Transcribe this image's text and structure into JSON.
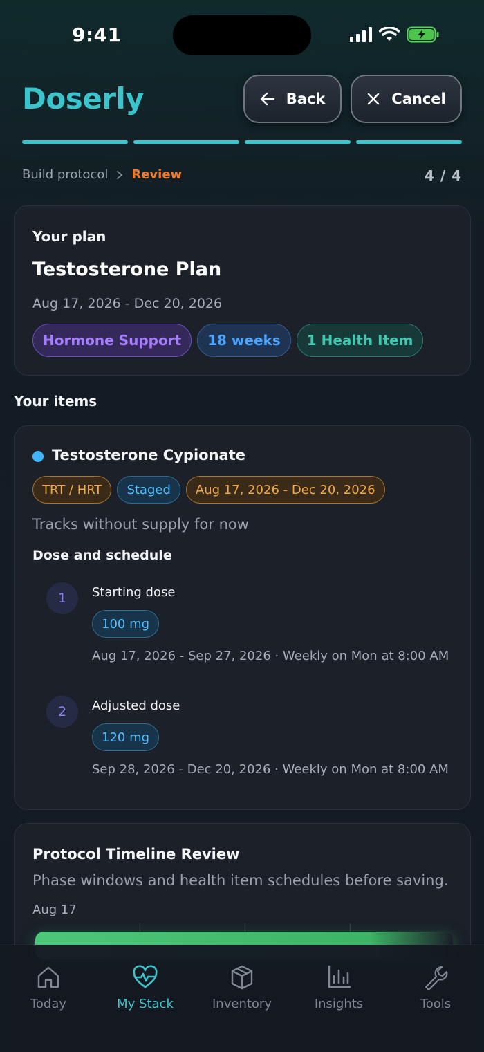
{
  "status": {
    "time": "9:41"
  },
  "header": {
    "brand": "Doserly",
    "back_label": "Back",
    "cancel_label": "Cancel",
    "progress_steps": 4,
    "progress_completed": 4
  },
  "breadcrumb": {
    "parent": "Build protocol",
    "separator": ">",
    "current": "Review",
    "step": "4 / 4"
  },
  "plan": {
    "label": "Your plan",
    "title": "Testosterone Plan",
    "dates": "Aug 17, 2026 - Dec 20, 2026",
    "chips": [
      "Hormone Support",
      "18 weeks",
      "1 Health Item"
    ]
  },
  "items_section": {
    "title": "Your items"
  },
  "item": {
    "name": "Testosterone Cypionate",
    "dot_color": "#3fb6ff",
    "chips": [
      "TRT / HRT",
      "Staged",
      "Aug 17, 2026 - Dec 20, 2026"
    ],
    "note": "Tracks without supply for now",
    "subheading": "Dose and schedule",
    "doses": [
      {
        "number": "1",
        "label": "Starting dose",
        "amount": "100 mg",
        "schedule": "Aug 17, 2026 - Sep 27, 2026 · Weekly on Mon at 8:00 AM"
      },
      {
        "number": "2",
        "label": "Adjusted dose",
        "amount": "120 mg",
        "schedule": "Sep 28, 2026 - Dec 20, 2026 · Weekly on Mon at 8:00 AM"
      }
    ]
  },
  "timeline": {
    "title": "Protocol Timeline Review",
    "subtitle": "Phase windows and health item schedules before saving.",
    "start_date": "Aug 17",
    "bar_color": "#4cc779"
  },
  "nav": {
    "items": [
      {
        "label": "Today",
        "icon": "home-icon"
      },
      {
        "label": "My Stack",
        "icon": "heart-pulse-icon"
      },
      {
        "label": "Inventory",
        "icon": "box-icon"
      },
      {
        "label": "Insights",
        "icon": "bar-chart-icon"
      },
      {
        "label": "Tools",
        "icon": "wrench-icon"
      }
    ],
    "active": "My Stack"
  },
  "colors": {
    "brand": "#3cc4cc",
    "accent_orange": "#f07a2a"
  }
}
